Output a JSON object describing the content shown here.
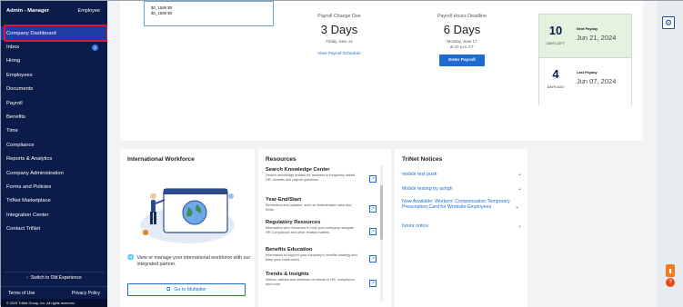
{
  "sidebar": {
    "role": "Admin - Manager",
    "employee_link": "Employee",
    "items": [
      {
        "label": "Company Dashboard"
      },
      {
        "label": "Inbox",
        "badge": "2"
      },
      {
        "label": "Hiring"
      },
      {
        "label": "Employees"
      },
      {
        "label": "Documents"
      },
      {
        "label": "Payroll"
      },
      {
        "label": "Benefits"
      },
      {
        "label": "Time"
      },
      {
        "label": "Compliance"
      },
      {
        "label": "Reports & Analytics"
      },
      {
        "label": "Company Administration"
      },
      {
        "label": "Forms and Policies"
      },
      {
        "label": "TriNet Marketplace"
      },
      {
        "label": "Integration Center"
      },
      {
        "label": "Contact TriNet"
      }
    ],
    "switch_label": "Switch to Old Experience",
    "terms": "Terms of Use",
    "privacy": "Privacy Policy",
    "copyright": "© 2023 TriNet Group, Inc. All rights reserved."
  },
  "mini_card": {
    "line1": "$0_1589 $0",
    "line2": "$0_1589 $0"
  },
  "payroll_change": {
    "label": "Payroll Change Due",
    "value": "3 Days",
    "date": "Friday, June 14",
    "link": "View Payroll Schedule"
  },
  "payroll_hours": {
    "label": "Payroll Hours Deadline",
    "value": "6 Days",
    "date": "Monday, June 17",
    "time": "at 10 a.m. CT",
    "button": "Enter Payroll"
  },
  "next_payday": {
    "num": "10",
    "caption": "DAYS LEFT",
    "title": "Next Payday",
    "date": "Jun 21, 2024"
  },
  "last_payday": {
    "num": "4",
    "caption": "DAYS AGO",
    "title": "Last Payday",
    "date": "Jun 07, 2024"
  },
  "international": {
    "title": "International Workforce",
    "text": "View or manage your international workforce with our integrated partner.",
    "button": "Go to Multiplier"
  },
  "resources": {
    "title": "Resources",
    "items": [
      {
        "title": "Search Knowledge Center",
        "desc": "Search knowledge articles for answers to frequently asked HR, benefits and payroll questions."
      },
      {
        "title": "Year-End/Start",
        "desc": "Reminders and updates, such as federal/state rates and limits."
      },
      {
        "title": "Regulatory Resources",
        "desc": "Information and resources to help your company navigate HR Compliance and other related matters."
      },
      {
        "title": "Benefits Education",
        "desc": "Information to support your company's benefits strategy and keep your costs down."
      },
      {
        "title": "Trends & Insights",
        "desc": "Videos, articles and webinars on trends in HR, compliance and more"
      }
    ]
  },
  "notices": {
    "title": "TriNet Notices",
    "items": [
      {
        "text": "mobile test push"
      },
      {
        "text": "Mobile testing by ashgh"
      },
      {
        "text": "Now Available: Workers' Compensation Temporary Prescription Card for Worksite Employees"
      },
      {
        "text": "future notice"
      }
    ]
  },
  "icons": {
    "gear": "gear-icon",
    "external": "external-link-icon",
    "chevron": "chevron-down-icon",
    "globe": "globe-icon"
  },
  "colors": {
    "sidebar_bg": "#0c1c4a",
    "active": "#1f3ba8",
    "highlight": "#e0142b",
    "accent": "#1d6ad0",
    "payday_bg": "#e4f2e0"
  }
}
